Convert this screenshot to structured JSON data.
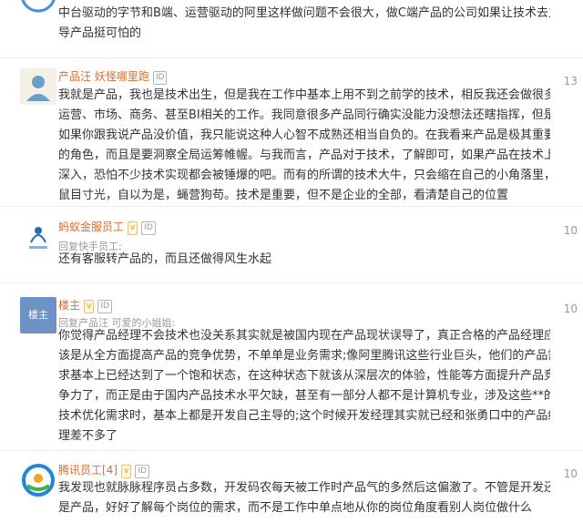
{
  "comments": [
    {
      "lines": [
        "中台驱动的字节和B端、运营驱动的阿里这样做问题不会很大，做C端产品的公司如果让技术去主",
        "导产品挺可怕的"
      ]
    },
    {
      "user": "产品汪 妖怪哪里跑",
      "id_badge": "ID",
      "likes": "13",
      "lines": [
        "我就是产品，我也是技术出生，但是我在工作中基本上用不到之前学的技术，相反我还会做很多",
        "运营、市场、商务、甚至BI相关的工作。我同意很多产品同行确实没能力没想法还瞎指挥，但是",
        "如果你跟我说产品没价值，我只能说这种人心智不成熟还相当自负的。在我看来产品是极其重要",
        "的角色，而且是要洞察全局运筹帷幄。与我而言，产品对于技术，了解即可，如果产品在技术上",
        "深入，恐怕不少技术实现都会被锤爆的吧。而有的所谓的技术大牛，只会缩在自己的小角落里，",
        "鼠目寸光，自以为是，蝇营狗苟。技术是重要，但不是企业的全部，看清楚自己的位置"
      ]
    },
    {
      "user": "蚂蚁金服员工",
      "level": "v",
      "id_badge": "ID",
      "likes": "10",
      "quote": "回复快手员工:",
      "lines": [
        "还有客服转产品的，而且还做得风生水起"
      ]
    },
    {
      "user": "楼主",
      "avatar_text": "楼主",
      "level": "v",
      "id_badge": "ID",
      "likes": "10",
      "quote": "回复产品汪 可爱的小姐姐:",
      "lines": [
        "你觉得产品经理不会技术也没关系其实就是被国内现在产品现状误导了，真正合格的产品经理应",
        "该是从全方面提高产品的竞争优势，不单单是业务需求;像阿里腾讯这些行业巨头，他们的产品需",
        "求基本上已经达到了一个饱和状态，在这种状态下就该从深层次的体验，性能等方面提升产品竞",
        "争力了，而正是由于国内产品技术水平欠缺，甚至有一部分人都不是计算机专业，涉及这些**的",
        "技术优化需求时，基本上都是开发自己主导的;这个时候开发经理其实就已经和张勇口中的产品经",
        "理差不多了"
      ]
    },
    {
      "user": "腾讯员工[4]",
      "level": "v",
      "id_badge": "ID",
      "likes": "10",
      "lines": [
        "我发现也就脉脉程序员占多数，开发码农每天被工作时产品气的多然后这偏激了。不管是开发还",
        "是产品，好好了解每个岗位的需求，而不是工作中单点地从你的岗位角度看别人岗位做什么"
      ]
    }
  ]
}
